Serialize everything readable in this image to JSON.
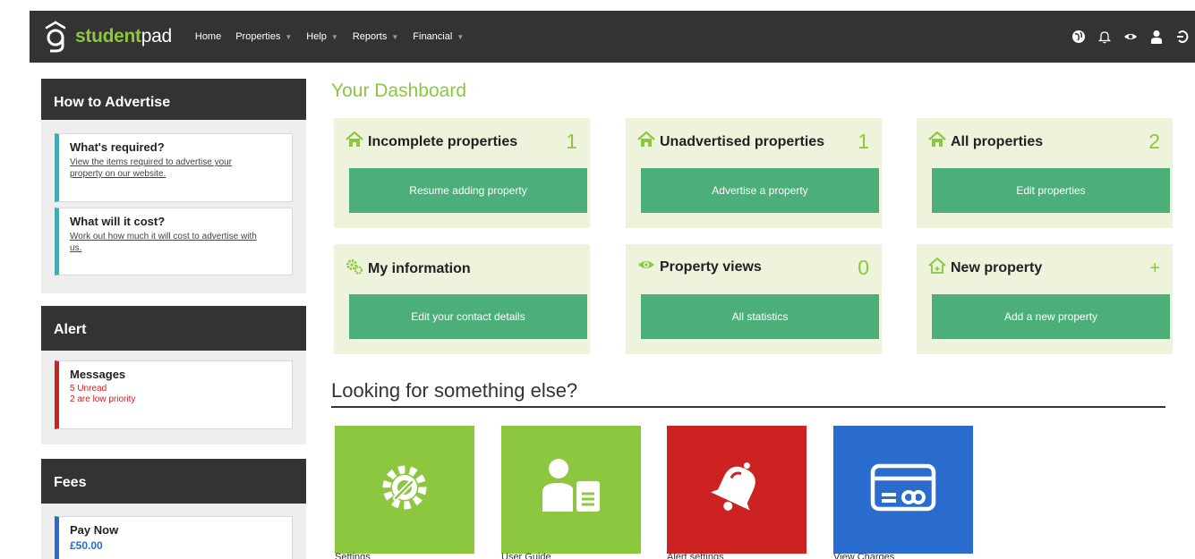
{
  "topbar": {
    "logo": {
      "bold": "student",
      "regular": "pad"
    },
    "nav": [
      {
        "label": "Home",
        "has_caret": false
      },
      {
        "label": "Properties",
        "has_caret": true
      },
      {
        "label": "Help",
        "has_caret": true
      },
      {
        "label": "Reports",
        "has_caret": true
      },
      {
        "label": "Financial",
        "has_caret": true
      }
    ],
    "caret_glyph": "▼",
    "icons": [
      "globe-icon",
      "bell-icon",
      "eye-icon",
      "user-icon",
      "logout-icon"
    ]
  },
  "sidebar": {
    "advertise": {
      "heading": "How to Advertise",
      "cards": [
        {
          "title": "What's required?",
          "link": "View the items required to advertise your property on our website."
        },
        {
          "title": "What will it cost?",
          "link": "Work out how much it will cost to advertise with us."
        }
      ]
    },
    "alert": {
      "heading": "Alert",
      "title": "Messages",
      "line1": "5 Unread",
      "line2": "2 are low priority"
    },
    "fees": {
      "heading": "Fees",
      "title": "Pay Now",
      "amount": "£50.00"
    }
  },
  "dashboard": {
    "title": "Your Dashboard",
    "tiles": [
      {
        "title": "Incomplete properties",
        "count": "1",
        "button": "Resume adding property",
        "icon": "home-icon"
      },
      {
        "title": "Unadvertised properties",
        "count": "1",
        "button": "Advertise a property",
        "icon": "home-icon"
      },
      {
        "title": "All properties",
        "count": "2",
        "button": "Edit properties",
        "icon": "home-icon"
      },
      {
        "title": "My information",
        "count": "",
        "button": "Edit your contact details",
        "icon": "gears-icon"
      },
      {
        "title": "Property views",
        "count": "0",
        "button": "All statistics",
        "icon": "eye-icon"
      },
      {
        "title": "New property",
        "count": "+",
        "button": "Add a new property",
        "icon": "home-outline-icon"
      }
    ]
  },
  "looking": {
    "heading": "Looking for something else?",
    "tiles": [
      {
        "label": "Settings",
        "icon": "settings-icon",
        "color": "#8dc63f"
      },
      {
        "label": "User Guide",
        "icon": "user-guide-icon",
        "color": "#8dc63f"
      },
      {
        "label": "Alert settings",
        "icon": "bell-icon",
        "color": "#cc2222"
      },
      {
        "label": "View Charges",
        "icon": "credit-card-icon",
        "color": "#2a6ccd"
      }
    ]
  },
  "colors": {
    "accent_green": "#8dc63f",
    "button_green": "#4caf7a",
    "tile_bg": "#eef3dc",
    "dark_bar": "#333333",
    "alert_red": "#cc2222",
    "fee_blue": "#2a6ccd"
  }
}
